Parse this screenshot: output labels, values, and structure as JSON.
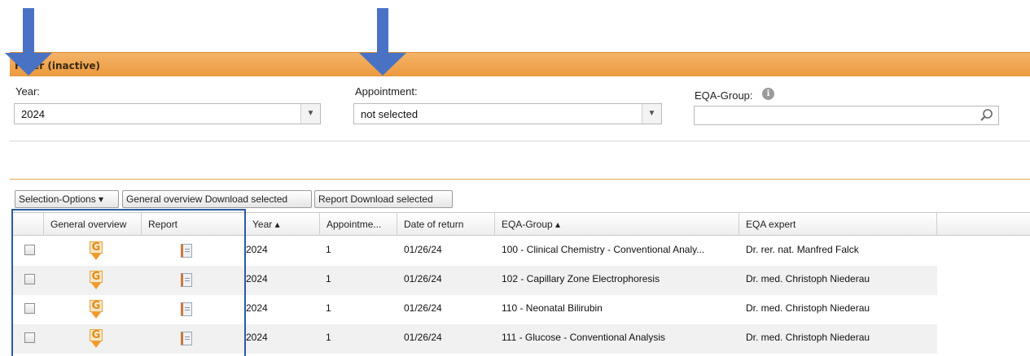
{
  "filter": {
    "title": "Filter (inactive)",
    "year_label": "Year:",
    "year_value": "2024",
    "appointment_label": "Appointment:",
    "appointment_value": "not selected",
    "eqa_group_label": "EQA-Group:",
    "eqa_group_value": ""
  },
  "toolbar": {
    "selection_options": "Selection-Options ▾",
    "general_overview_download": "General overview Download selected",
    "report_download": "Report Download selected"
  },
  "table": {
    "columns": [
      "General overview",
      "Report",
      "Year ▴",
      "Appointme...",
      "Date of return",
      "EQA-Group ▴",
      "EQA expert"
    ],
    "rows": [
      {
        "year": "2024",
        "appointment": "1",
        "date": "01/26/24",
        "group": "100 - Clinical Chemistry - Conventional Analy...",
        "expert": "Dr. rer. nat. Manfred Falck"
      },
      {
        "year": "2024",
        "appointment": "1",
        "date": "01/26/24",
        "group": "102 - Capillary Zone Electrophoresis",
        "expert": "Dr. med. Christoph Niederau"
      },
      {
        "year": "2024",
        "appointment": "1",
        "date": "01/26/24",
        "group": "110 - Neonatal Bilirubin",
        "expert": "Dr. med. Christoph Niederau"
      },
      {
        "year": "2024",
        "appointment": "1",
        "date": "01/26/24",
        "group": "111 - Glucose - Conventional Analysis",
        "expert": "Dr. med. Christoph Niederau"
      }
    ]
  },
  "icons": {
    "general_overview": "g-download-icon",
    "report": "report-document-icon",
    "info": "info-icon",
    "search": "search-icon",
    "annotation_arrow": "arrow-down-icon"
  },
  "colors": {
    "filter_bar": "#eb9a3e",
    "arrow": "#4a72c4",
    "highlight_box": "#2a5c9e"
  }
}
